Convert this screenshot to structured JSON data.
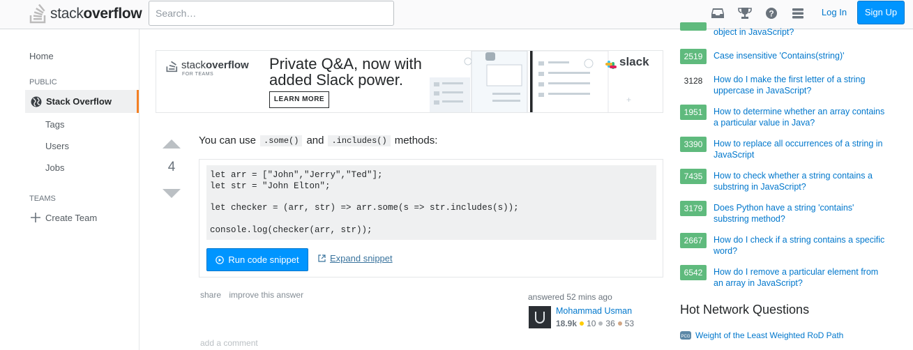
{
  "header": {
    "logo_word_light": "stack",
    "logo_word_bold": "overflow",
    "search_placeholder": "Search…",
    "login_label": "Log In",
    "signup_label": "Sign Up"
  },
  "leftnav": {
    "home": "Home",
    "public_heading": "PUBLIC",
    "active_item": "Stack Overflow",
    "sub_items": [
      "Tags",
      "Users",
      "Jobs"
    ],
    "teams_heading": "TEAMS",
    "create_team": "Create Team"
  },
  "ad": {
    "logo_light": "stack",
    "logo_bold": "overflow",
    "logo_sub": "FOR TEAMS",
    "headline_line1": "Private Q&A, now with",
    "headline_line2": "added Slack power.",
    "button": "LEARN MORE",
    "partner": "slack"
  },
  "answer": {
    "vote_count": "4",
    "text_before": "You can use",
    "code1": ".some()",
    "text_mid": "and",
    "code2": ".includes()",
    "text_after": "methods:",
    "code": "let arr = [\"John\",\"Jerry\",\"Ted\"];\nlet str = \"John Elton\";\n\nlet checker = (arr, str) => arr.some(s => str.includes(s));\n\nconsole.log(checker(arr, str));",
    "run_label": "Run code snippet",
    "expand_label": "Expand snippet",
    "share": "share",
    "improve": "improve this answer",
    "answered": "answered 52 mins ago",
    "user_name": "Mohammad Usman",
    "user_rep": "18.9k",
    "gold": "10",
    "silver": "36",
    "bronze": "53",
    "add_comment": "add a comment"
  },
  "related": [
    {
      "score": "",
      "title": "object in JavaScript?"
    },
    {
      "score": "2519",
      "title": "Case insensitive 'Contains(string)'"
    },
    {
      "score": "3128",
      "title": "How do I make the first letter of a string uppercase in JavaScript?"
    },
    {
      "score": "1951",
      "title": "How to determine whether an array contains a particular value in Java?"
    },
    {
      "score": "3390",
      "title": "How to replace all occurrences of a string in JavaScript"
    },
    {
      "score": "7435",
      "title": "How to check whether a string contains a substring in JavaScript?"
    },
    {
      "score": "3179",
      "title": "Does Python have a string 'contains' substring method?"
    },
    {
      "score": "2667",
      "title": "How do I check if a string contains a specific word?"
    },
    {
      "score": "6542",
      "title": "How do I remove a particular element from an array in JavaScript?"
    }
  ],
  "hnq": {
    "heading": "Hot Network Questions",
    "items": [
      "Weight of the Least Weighted RoD Path"
    ]
  },
  "colors": {
    "accent_blue": "#0095ff",
    "accepted_green": "#5fba7d",
    "nav_active_bar": "#f48024"
  }
}
